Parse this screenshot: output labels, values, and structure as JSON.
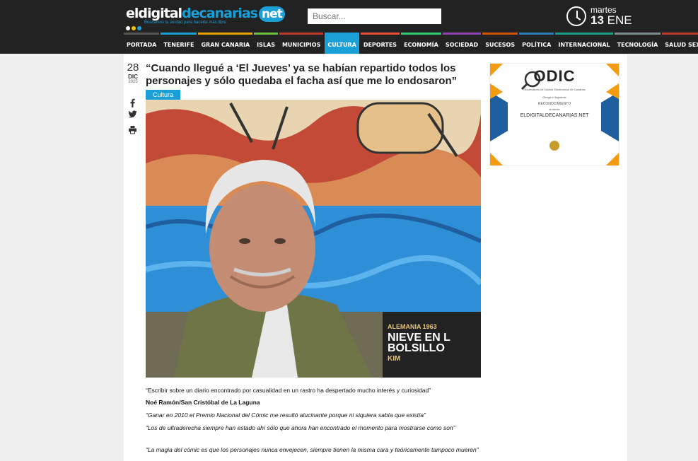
{
  "header": {
    "logo": {
      "part1": "eldigital",
      "part2": "decanarias",
      "part3": "net",
      "tagline": "Buscamos la verdad para hacerte más libre"
    },
    "search_placeholder": "Buscar...",
    "weekday": "martes",
    "day": "13",
    "month": "ENE"
  },
  "nav": {
    "items": [
      {
        "label": "PORTADA",
        "color": "#555"
      },
      {
        "label": "TENERIFE",
        "color": "#1a9fd7"
      },
      {
        "label": "GRAN CANARIA",
        "color": "#e6a400"
      },
      {
        "label": "ISLAS",
        "color": "#6fbf3f"
      },
      {
        "label": "MUNICIPIOS",
        "color": "#c0392b"
      },
      {
        "label": "CULTURA",
        "color": "#1a9fd7"
      },
      {
        "label": "DEPORTES",
        "color": "#e74c3c"
      },
      {
        "label": "ECONOMÍA",
        "color": "#2ecc71"
      },
      {
        "label": "SOCIEDAD",
        "color": "#8e44ad"
      },
      {
        "label": "SUCESOS",
        "color": "#d35400"
      },
      {
        "label": "POLÍTICA",
        "color": "#2980b9"
      },
      {
        "label": "INTERNACIONAL",
        "color": "#16a085"
      },
      {
        "label": "TECNOLOGÍA",
        "color": "#7f8c8d"
      },
      {
        "label": "SALUD SEXUAL",
        "color": "#c0392b"
      }
    ],
    "active_index": 5
  },
  "article": {
    "date_day": "28",
    "date_month": "DIC",
    "date_year": "2025",
    "title": "“Cuando llegué a ‘El Jueves’ ya se habían repartido todos los personajes y sólo quedaba el facha así que me lo endosaron”",
    "category": "Cultura",
    "caption": "“Escribir sobre un diario encontrado por casualidad en un rastro ha despertado mucho interés y curiosidad”",
    "author": "Noé Ramón/San Cristóbal de La Laguna",
    "quotes": [
      "“Ganar en 2010 el Premio Nacional del Cómic me resultó alucinante porque ni siquiera sabía que existía”",
      "“Los de ultraderecha siempre han estado ahí sólo que ahora han encontrado el momento para mostrarse como son”",
      "“La magia del cómic es que los personajes nunca envejecen, siempre tienen la misma cara y teóricamente tampoco mueren”"
    ],
    "book_line1": "ALEMANIA 1963",
    "book_line2": "NIEVE EN L",
    "book_line3": "BOLSILLO",
    "book_author": "KIM"
  },
  "ad": {
    "brand": "ODIC",
    "subtitle": "Observatorio de Diarios Electrónicos de Canarias",
    "award_to": "Otorga el siguiente",
    "award": "RECONOCIMIENTO",
    "to": "al medio",
    "site": "ELDIGITALDECANARIAS.NET"
  },
  "colors": {
    "accent": "#1a9fd7",
    "header_bg": "#222222"
  }
}
